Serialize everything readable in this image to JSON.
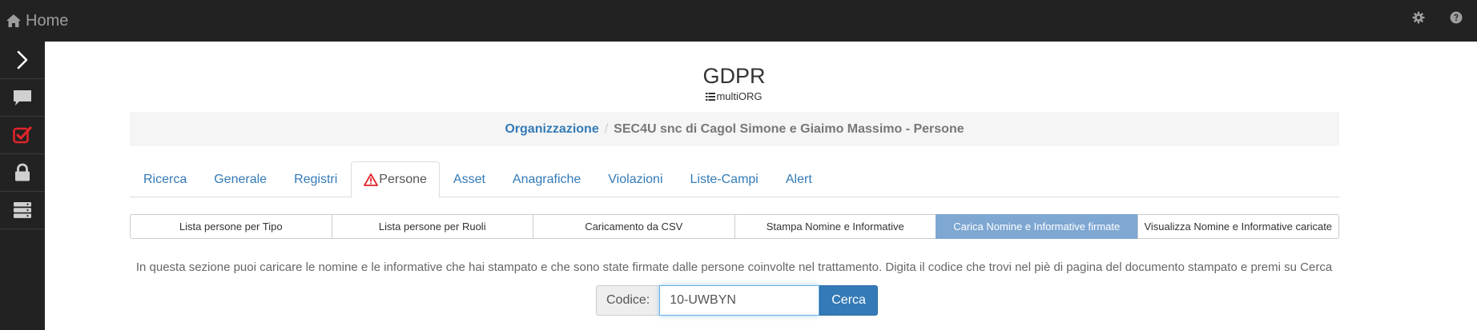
{
  "navbar": {
    "home_label": "Home",
    "icons": {
      "home": "home-icon",
      "settings": "gear-icon",
      "help": "help-icon"
    }
  },
  "sidebar": {
    "items": [
      {
        "icon": "chevron-right-icon"
      },
      {
        "icon": "chat-bubble-icon"
      },
      {
        "icon": "checkbox-checked-icon"
      },
      {
        "icon": "lock-icon"
      },
      {
        "icon": "server-icon"
      }
    ]
  },
  "header": {
    "title": "GDPR",
    "subtitle": "multiORG"
  },
  "breadcrumb": {
    "link": "Organizzazione",
    "separator": "/",
    "current": "SEC4U snc di Cagol Simone e Giaimo Massimo - Persone"
  },
  "tabs": [
    {
      "label": "Ricerca",
      "active": false
    },
    {
      "label": "Generale",
      "active": false
    },
    {
      "label": "Registri",
      "active": false
    },
    {
      "label": "Persone",
      "active": true,
      "icon": "warning-icon"
    },
    {
      "label": "Asset",
      "active": false
    },
    {
      "label": "Anagrafiche",
      "active": false
    },
    {
      "label": "Violazioni",
      "active": false
    },
    {
      "label": "Liste-Campi",
      "active": false
    },
    {
      "label": "Alert",
      "active": false
    }
  ],
  "subtabs": [
    {
      "label": "Lista persone per Tipo",
      "active": false
    },
    {
      "label": "Lista persone per Ruoli",
      "active": false
    },
    {
      "label": "Caricamento da CSV",
      "active": false
    },
    {
      "label": "Stampa Nomine e Informative",
      "active": false
    },
    {
      "label": "Carica Nomine e Informative firmate",
      "active": true
    },
    {
      "label": "Visualizza Nomine e Informative caricate",
      "active": false
    }
  ],
  "info_text": "In questa sezione puoi caricare le nomine e le informative che hai stampato e che sono state firmate dalle persone coinvolte nel trattamento. Digita il codice che trovi nel piè di pagina del documento stampato e premi su Cerca",
  "search": {
    "label": "Codice:",
    "value": "10-UWBYN",
    "button_label": "Cerca"
  },
  "colors": {
    "navbar_bg": "#222222",
    "link": "#337ab7",
    "active_subtab": "#7ea7d2",
    "primary_button": "#337ab7",
    "checkbox_icon": "#e0242b"
  }
}
